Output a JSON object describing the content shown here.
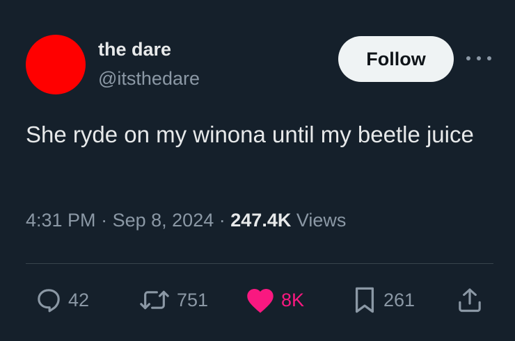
{
  "tweet": {
    "author": {
      "name": "the dare",
      "handle": "@itsthedare",
      "avatar_color": "#ff0000"
    },
    "follow_label": "Follow",
    "text": "She ryde on my winona until my beetle juice",
    "time": "4:31 PM",
    "separator": "·",
    "date": "Sep 8, 2024",
    "views_count": "247.4K",
    "views_label": "Views",
    "actions": {
      "replies": "42",
      "reposts": "751",
      "likes": "8K",
      "bookmarks": "261"
    }
  },
  "colors": {
    "background": "#15202b",
    "primary_text": "#e7e9ea",
    "secondary_text": "#8b98a5",
    "like_pink": "#f91880",
    "follow_bg": "#eff3f4"
  },
  "icons": [
    "reply-icon",
    "repost-icon",
    "like-icon",
    "bookmark-icon",
    "share-icon",
    "more-icon"
  ]
}
